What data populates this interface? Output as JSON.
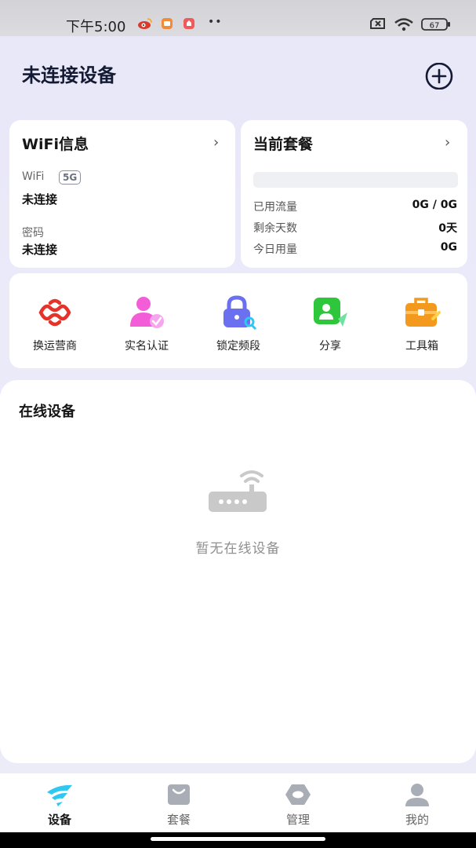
{
  "status_bar": {
    "time": "下午5:00",
    "battery": "67"
  },
  "header": {
    "title": "未连接设备"
  },
  "wifi_card": {
    "title": "WiFi信息",
    "wifi_label": "WiFi",
    "band": "5G",
    "wifi_status": "未连接",
    "password_label": "密码",
    "password_status": "未连接"
  },
  "plan_card": {
    "title": "当前套餐",
    "usage_fraction": 0,
    "rows": [
      {
        "label": "已用流量",
        "value": "0G / 0G"
      },
      {
        "label": "剩余天数",
        "value": "0天"
      },
      {
        "label": "今日用量",
        "value": "0G"
      }
    ]
  },
  "shortcuts": [
    {
      "label": "换运营商",
      "icon": "unicom-knot-icon"
    },
    {
      "label": "实名认证",
      "icon": "verified-user-icon"
    },
    {
      "label": "锁定频段",
      "icon": "lock-key-icon"
    },
    {
      "label": "分享",
      "icon": "share-chat-icon"
    },
    {
      "label": "工具箱",
      "icon": "toolbox-icon"
    }
  ],
  "devices": {
    "title": "在线设备",
    "empty_text": "暂无在线设备"
  },
  "nav": [
    {
      "label": "设备",
      "active": true
    },
    {
      "label": "套餐",
      "active": false
    },
    {
      "label": "管理",
      "active": false
    },
    {
      "label": "我的",
      "active": false
    }
  ],
  "colors": {
    "accent": "#2fc8f0",
    "title": "#141a33",
    "unicom_red": "#e5332a",
    "pink": "#f35dd8",
    "purple": "#6a70f0",
    "green": "#2ec63a",
    "orange": "#f39a1e"
  }
}
